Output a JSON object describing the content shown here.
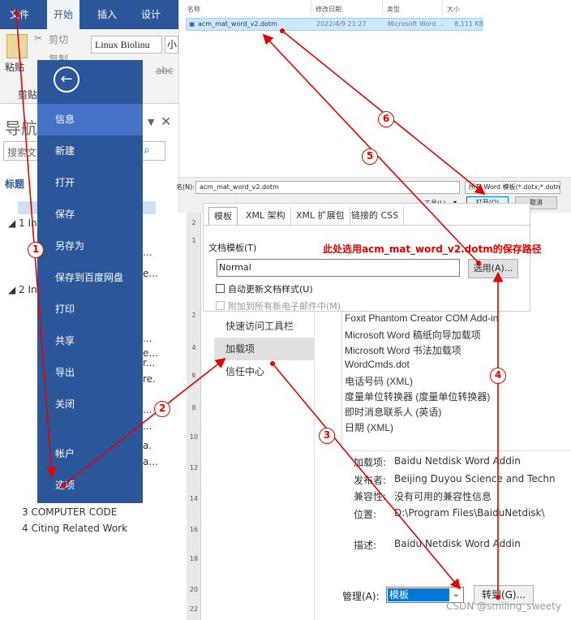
{
  "ribbon": {
    "tabs": [
      "文件",
      "开始",
      "插入",
      "设计"
    ],
    "active_tab": "开始",
    "paste_label": "粘贴",
    "cut_label": "剪切",
    "copy_label": "复制",
    "clipboard_label": "剪贴",
    "font_name": "Linux Biolinu",
    "font_size": "小",
    "strike_sample": "abc"
  },
  "nav": {
    "title": "导航",
    "search_placeholder": "搜索文",
    "headings_label": "标题",
    "items": [
      "1 In",
      "2 In",
      "3 COMPUTER CODE",
      "4 Citing Related Work"
    ],
    "fragments": [
      "...",
      "e...",
      "...",
      "e...",
      "r...",
      "re.",
      "...",
      "...",
      "a.",
      "a..."
    ]
  },
  "backstage": {
    "items": [
      "信息",
      "新建",
      "打开",
      "保存",
      "另存为",
      "保存到百度网盘",
      "打印",
      "共享",
      "导出",
      "关闭",
      "帐户",
      "选项"
    ],
    "selected": "信息"
  },
  "file_dialog": {
    "columns": [
      "名称",
      "修改日期",
      "类型",
      "大小"
    ],
    "file": {
      "name": "acm_mat_word_v2.dotm",
      "date": "2022/4/9 21:27",
      "type": "Microsoft Word ...",
      "size": "8,111 KB"
    },
    "filename_label": "名(N):",
    "filename_value": "acm_mat_word_v2.dotm",
    "filter_value": "所有 Word 模板(*.dotx;*.dotm",
    "tools_label": "工具(L)",
    "open_label": "打开(O)",
    "cancel_label": "取消"
  },
  "templates_dialog": {
    "tabs": [
      "模板",
      "XML 架构",
      "XML 扩展包",
      "链接的 CSS"
    ],
    "doc_template_label": "文档模板(T)",
    "template_value": "Normal",
    "choose_button": "选用(A)...",
    "auto_update_label": "自动更新文档样式(U)",
    "attach_label": "附加到所有新电子邮件中(M)"
  },
  "options": {
    "categories": [
      "快速访问工具栏",
      "加载项",
      "信任中心"
    ],
    "selected_category": "加载项",
    "addins": [
      "Foxit Phantom Creator COM Add-in",
      "Microsoft Word 稿纸向导加载项",
      "Microsoft Word 书法加载项",
      "WordCmds.dot",
      "电话号码 (XML)",
      "度量单位转换器 (度量单位转换器)",
      "即时消息联系人 (英语)",
      "日期 (XML)"
    ],
    "details": [
      {
        "label": "加载项:",
        "value": "Baidu Netdisk Word Addin"
      },
      {
        "label": "发布者:",
        "value": "Beijing Duyou Science and Techn"
      },
      {
        "label": "兼容性:",
        "value": "没有可用的兼容性信息"
      },
      {
        "label": "位置:",
        "value": "D:\\Program Files\\BaiduNetdisk\\"
      },
      {
        "label": "描述:",
        "value": "Baidu Netdisk Word Addin"
      }
    ],
    "manage_label": "管理(A):",
    "manage_value": "模板",
    "go_button": "转到(G)..."
  },
  "ruler_numbers": [
    "2",
    "1",
    "2",
    "4",
    "6",
    "8",
    "10",
    "12",
    "14",
    "16",
    "18",
    "20",
    "22"
  ],
  "annotation": "此处选用acm_mat_word_v2.dotm的保存路径",
  "steps": [
    "1",
    "2",
    "3",
    "4",
    "5",
    "6"
  ],
  "watermark": "CSDN @smiling_sweety",
  "colors": {
    "word_blue": "#2b579a",
    "selected_blue": "#4472c4",
    "arrow_red": "#e60000"
  }
}
